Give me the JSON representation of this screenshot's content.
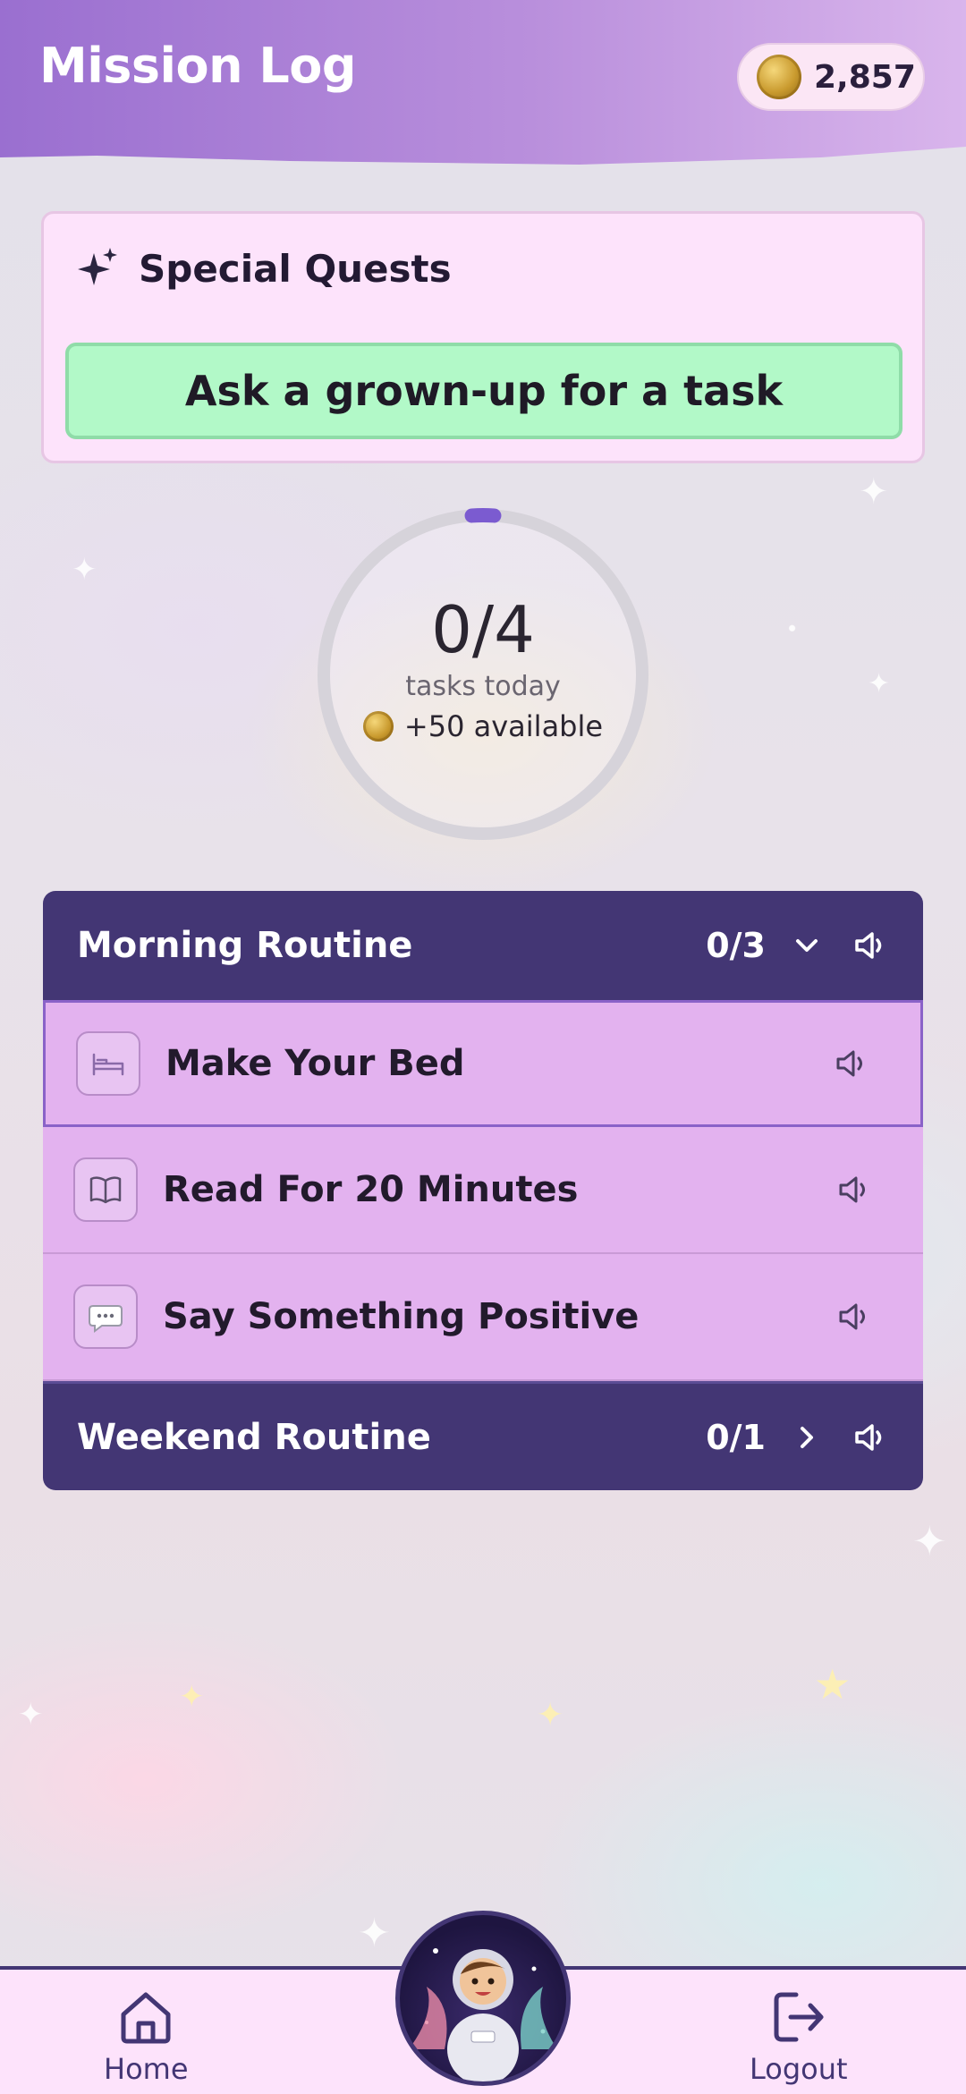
{
  "header": {
    "title": "Mission Log",
    "coins": "2,857"
  },
  "quests": {
    "title": "Special Quests",
    "button_label": "Ask a grown-up for a task"
  },
  "progress": {
    "count": "0/4",
    "subtitle": "tasks today",
    "reward": "+50 available",
    "completed_fraction": 0
  },
  "routines": [
    {
      "name": "Morning Routine",
      "count": "0/3",
      "expanded": true,
      "tasks": [
        {
          "name": "Make Your Bed",
          "icon": "bed-icon"
        },
        {
          "name": "Read For 20 Minutes",
          "icon": "book-icon"
        },
        {
          "name": "Say Something Positive",
          "icon": "speech-bubble-icon"
        }
      ]
    },
    {
      "name": "Weekend Routine",
      "count": "0/1",
      "expanded": false
    }
  ],
  "nav": {
    "home_label": "Home",
    "logout_label": "Logout"
  },
  "colors": {
    "header_gradient_start": "#9a6fd0",
    "header_gradient_end": "#d9b5ec",
    "routine_header": "#433674",
    "task_bg": "#e3b2ef",
    "quest_button": "#b2f9c8",
    "progress_ring": "#d8d6dc",
    "progress_accent": "#7b5bd0"
  }
}
